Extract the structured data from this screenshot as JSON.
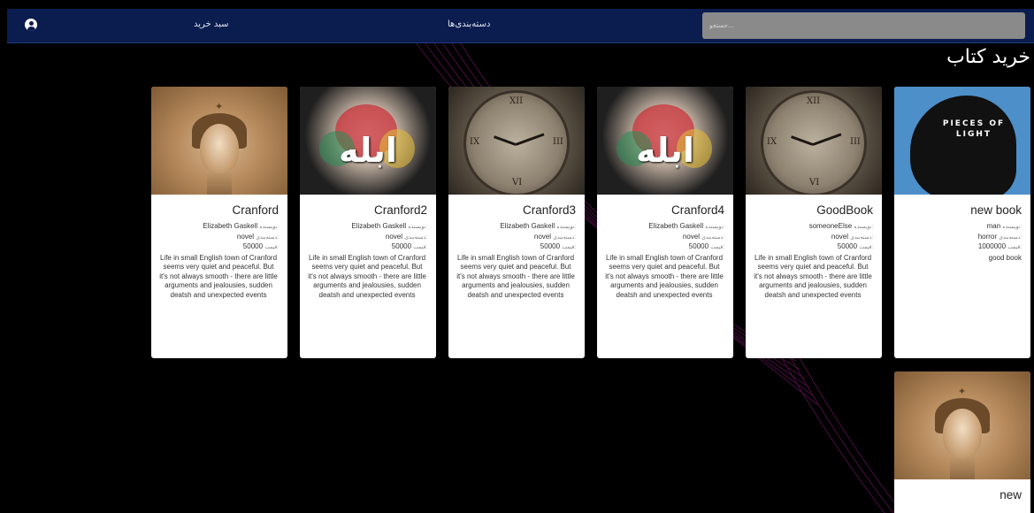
{
  "nav": {
    "cart_label": "سبد خرید",
    "categories_label": "دسته‌بندی‌ها",
    "search_placeholder": "جستجو..."
  },
  "page_title": "خرید کتاب",
  "labels": {
    "author": "نویسنده:",
    "category": "دسته‌بندی:",
    "price": "قیمت:"
  },
  "books": [
    {
      "title": "Cranford",
      "author": "Elizabeth Gaskell",
      "category": "novel",
      "price": "50000",
      "description": "Life in small English town of Cranford seems very quiet and peaceful. But it's not always smooth - there are little arguments and jealousies, sudden deatsh and unexpected events",
      "cover": "woman-portrait"
    },
    {
      "title": "Cranford2",
      "author": "Elizabeth Gaskell",
      "category": "novel",
      "price": "50000",
      "description": "Life in small English town of Cranford seems very quiet and peaceful. But it's not always smooth - there are little arguments and jealousies, sudden deatsh and unexpected events",
      "cover": "ablah-art",
      "cover_text": "ابله"
    },
    {
      "title": "Cranford3",
      "author": "Elizabeth Gaskell",
      "category": "novel",
      "price": "50000",
      "description": "Life in small English town of Cranford seems very quiet and peaceful. But it's not always smooth - there are little arguments and jealousies, sudden deatsh and unexpected events",
      "cover": "clock"
    },
    {
      "title": "Cranford4",
      "author": "Elizabeth Gaskell",
      "category": "novel",
      "price": "50000",
      "description": "Life in small English town of Cranford seems very quiet and peaceful. But it's not always smooth - there are little arguments and jealousies, sudden deatsh and unexpected events",
      "cover": "ablah-art",
      "cover_text": "ابله"
    },
    {
      "title": "GoodBook",
      "author": "someoneElse",
      "category": "novel",
      "price": "50000",
      "description": "Life in small English town of Cranford seems very quiet and peaceful. But it's not always smooth - there are little arguments and jealousies, sudden deatsh and unexpected events",
      "cover": "clock"
    },
    {
      "title": "new book",
      "author": "man",
      "category": "horror",
      "price": "1000000",
      "description": "good book",
      "cover": "pieces-of-light",
      "cover_text": "PIECES OF LIGHT"
    },
    {
      "title": "new",
      "cover": "woman-portrait"
    }
  ],
  "colors": {
    "navbar": "#0b1d4f",
    "background": "#000000",
    "card": "#ffffff",
    "search": "#8a8a8a"
  }
}
